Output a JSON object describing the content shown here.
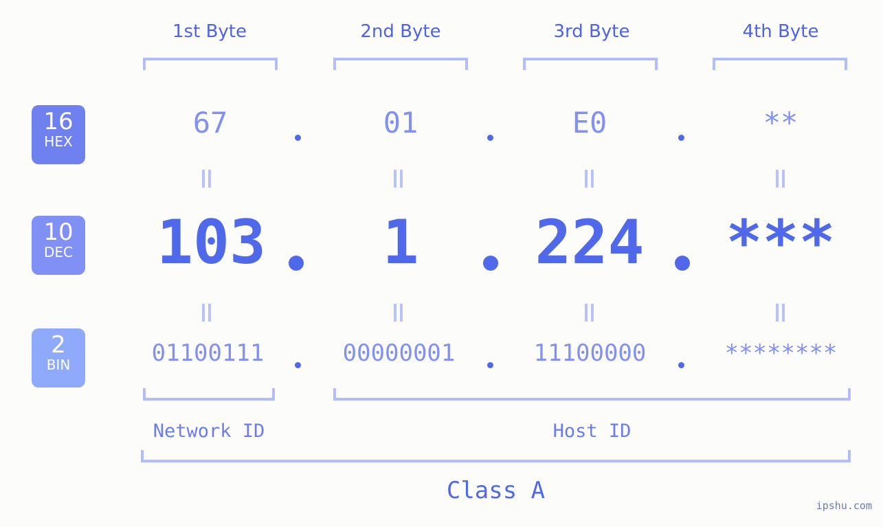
{
  "background_color": "#fcfdfa",
  "accent_color": "#5068ea",
  "light_accent_color": "#b4bdfb",
  "header": {
    "bytes": [
      {
        "label": "1st Byte"
      },
      {
        "label": "2nd Byte"
      },
      {
        "label": "3rd Byte"
      },
      {
        "label": "4th Byte"
      }
    ]
  },
  "radix_badges": [
    {
      "number": "16",
      "abbr": "HEX",
      "color": "#6f80ef"
    },
    {
      "number": "10",
      "abbr": "DEC",
      "color": "#8090f5"
    },
    {
      "number": "2",
      "abbr": "BIN",
      "color": "#8faafb"
    }
  ],
  "rows": {
    "hex": {
      "radix": "16",
      "name": "HEX",
      "octets": [
        "67",
        "01",
        "E0",
        "**"
      ],
      "separator": "."
    },
    "dec": {
      "radix": "10",
      "name": "DEC",
      "octets": [
        "103",
        "1",
        "224",
        "***"
      ],
      "separator": "."
    },
    "bin": {
      "radix": "2",
      "name": "BIN",
      "octets": [
        "01100111",
        "00000001",
        "11100000",
        "********"
      ],
      "separator": "."
    }
  },
  "equals_symbol": "‖",
  "footer": {
    "network_id_label": "Network ID",
    "host_id_label": "Host ID",
    "class_label": "Class A"
  },
  "watermark": "ipshu.com"
}
